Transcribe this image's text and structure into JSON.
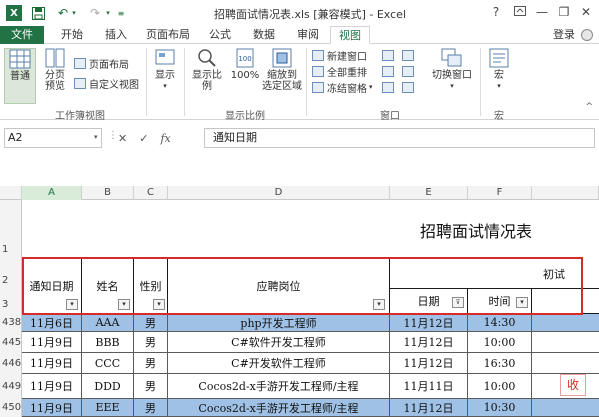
{
  "window": {
    "title": "招聘面试情况表.xls [兼容模式] - Excel",
    "help": "?",
    "minimize": "—",
    "restore": "❐",
    "close": "✕"
  },
  "quick_access": {
    "undo": "↶",
    "redo": "↷"
  },
  "tabs": [
    "文件",
    "开始",
    "插入",
    "页面布局",
    "公式",
    "数据",
    "审阅",
    "视图"
  ],
  "account": {
    "login": "登录"
  },
  "ribbon": {
    "workbook_views": {
      "normal": "普通",
      "page_break_1": "分页",
      "page_break_2": "预览",
      "page_layout": "页面布局",
      "custom_views": "自定义视图",
      "label": "工作簿视图"
    },
    "show": {
      "show": "显示"
    },
    "zoom": {
      "zoom": "显示比例",
      "zoom_100": "100%",
      "zoom_sel_1": "缩放到",
      "zoom_sel_2": "选定区域",
      "label": "显示比例"
    },
    "window": {
      "new_window": "新建窗口",
      "arrange_all": "全部重排",
      "freeze": "冻结窗格",
      "switch": "切换窗口",
      "label": "窗口"
    },
    "macros": {
      "macros": "宏",
      "label": "宏"
    }
  },
  "formula_bar": {
    "name_box": "A2",
    "cancel": "✕",
    "enter": "✓",
    "fx": "fx",
    "content": "通知日期"
  },
  "sheet": {
    "columns": [
      "A",
      "B",
      "C",
      "D",
      "E",
      "F"
    ],
    "row_labels": [
      "1",
      "2",
      "3"
    ],
    "title": "招聘面试情况表",
    "headers": {
      "notice_date": "通知日期",
      "name": "姓名",
      "gender": "性别",
      "position": "应聘岗位",
      "first_interview": "初试",
      "date": "日期",
      "time": "时间"
    },
    "rows": [
      {
        "row": "438",
        "date": "11月6日",
        "name": "AAA",
        "gender": "男",
        "position": "php开发工程师",
        "idate": "11月12日",
        "time": "14:30",
        "highlight": true
      },
      {
        "row": "445",
        "date": "11月9日",
        "name": "BBB",
        "gender": "男",
        "position": "C#软件开发工程师",
        "idate": "11月12日",
        "time": "10:00",
        "highlight": false
      },
      {
        "row": "446",
        "date": "11月9日",
        "name": "CCC",
        "gender": "男",
        "position": "C#开发软件工程师",
        "idate": "11月12日",
        "time": "16:30",
        "highlight": false
      },
      {
        "row": "449",
        "date": "11月9日",
        "name": "DDD",
        "gender": "男",
        "position": "Cocos2d-x手游开发工程师/主程",
        "idate": "11月11日",
        "time": "10:00",
        "highlight": false
      },
      {
        "row": "450",
        "date": "11月9日",
        "name": "EEE",
        "gender": "男",
        "position": "Cocos2d-x手游开发工程师/主程",
        "idate": "11月12日",
        "time": "10:30",
        "highlight": true
      }
    ],
    "watermark": "收"
  },
  "colors": {
    "accent": "#217346",
    "highlight": "#9fc1e5",
    "frame": "#d52b2b"
  }
}
